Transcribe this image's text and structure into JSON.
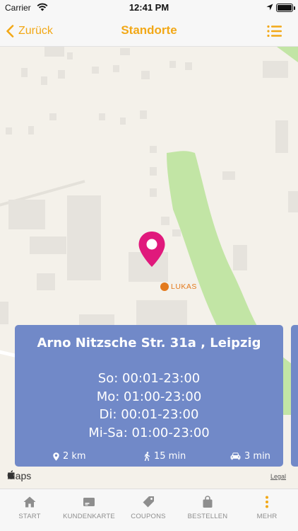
{
  "status_bar": {
    "carrier": "Carrier",
    "time": "12:41 PM",
    "icons": [
      "wifi-icon",
      "location-arrow-icon",
      "battery-icon"
    ]
  },
  "nav": {
    "back_label": "Zurück",
    "title": "Standorte",
    "list_icon": "list-icon",
    "accent_color": "#f2a817"
  },
  "map": {
    "poi_label": "LUKAS",
    "maps_label": "Maps",
    "legal_label": "Legal",
    "marker_color": "#e0197c"
  },
  "location": {
    "address": "Arno Nitzsche Str. 31a , Leipzig",
    "hours": [
      "So: 00:01-23:00",
      "Mo: 01:00-23:00",
      "Di: 00:01-23:00",
      "Mi-Sa: 01:00-23:00"
    ],
    "distance": "2 km",
    "walk_time": "15 min",
    "drive_time": "3 min",
    "card_color": "#7189c8"
  },
  "tabs": [
    {
      "label": "START",
      "icon": "home-icon"
    },
    {
      "label": "KUNDENKARTE",
      "icon": "card-icon"
    },
    {
      "label": "COUPONS",
      "icon": "tag-icon"
    },
    {
      "label": "BESTELLEN",
      "icon": "bag-icon"
    },
    {
      "label": "MEHR",
      "icon": "more-icon",
      "active": true
    }
  ]
}
